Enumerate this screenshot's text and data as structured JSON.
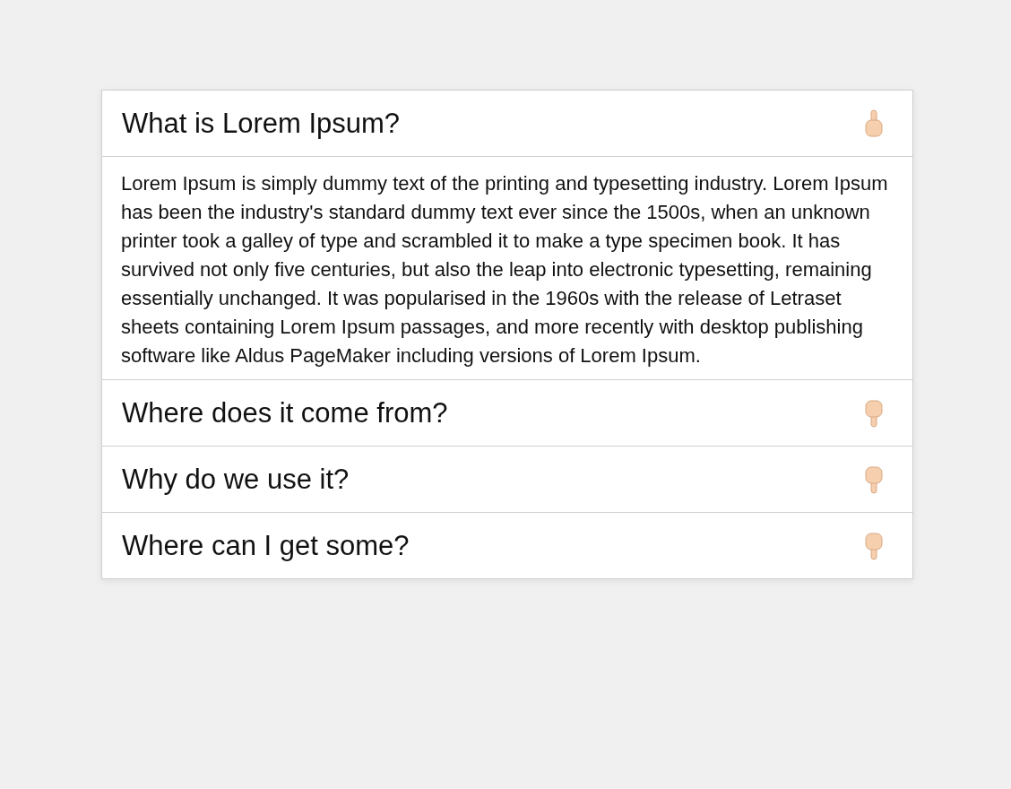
{
  "accordion": [
    {
      "title": "What is Lorem Ipsum?",
      "expanded": true,
      "body": "Lorem Ipsum is simply dummy text of the printing and typesetting industry. Lorem Ipsum has been the industry's standard dummy text ever since the 1500s, when an unknown printer took a galley of type and scrambled it to make a type specimen book. It has survived not only five centuries, but also the leap into electronic typesetting, remaining essentially unchanged. It was popularised in the 1960s with the release of Letraset sheets containing Lorem Ipsum passages, and more recently with desktop publishing software like Aldus PageMaker including versions of Lorem Ipsum."
    },
    {
      "title": "Where does it come from?",
      "expanded": false
    },
    {
      "title": "Why do we use it?",
      "expanded": false
    },
    {
      "title": "Where can I get some?",
      "expanded": false
    }
  ]
}
